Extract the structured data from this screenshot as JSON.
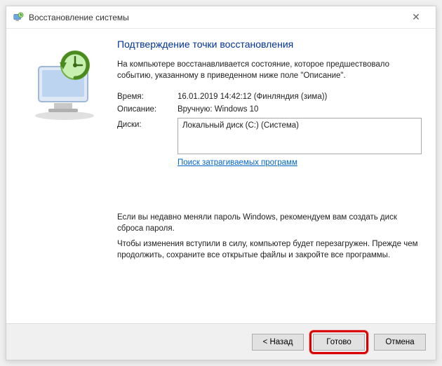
{
  "window": {
    "title": "Восстановление системы"
  },
  "content": {
    "heading": "Подтверждение точки восстановления",
    "description": "На компьютере восстанавливается состояние, которое предшествовало событию, указанному в приведенном ниже поле \"Описание\".",
    "time_label": "Время:",
    "time_value": "16.01.2019 14:42:12 (Финляндия (зима))",
    "desc_label": "Описание:",
    "desc_value": "Вручную: Windows 10",
    "disks_label": "Диски:",
    "disks_value": "Локальный диск (C:) (Система)",
    "link": "Поиск затрагиваемых программ",
    "note1": "Если вы недавно меняли пароль Windows, рекомендуем вам создать диск сброса пароля.",
    "note2": "Чтобы изменения вступили в силу, компьютер будет перезагружен. Прежде чем продолжить, сохраните все открытые файлы и закройте все программы."
  },
  "footer": {
    "back": "< Назад",
    "finish": "Готово",
    "cancel": "Отмена"
  }
}
